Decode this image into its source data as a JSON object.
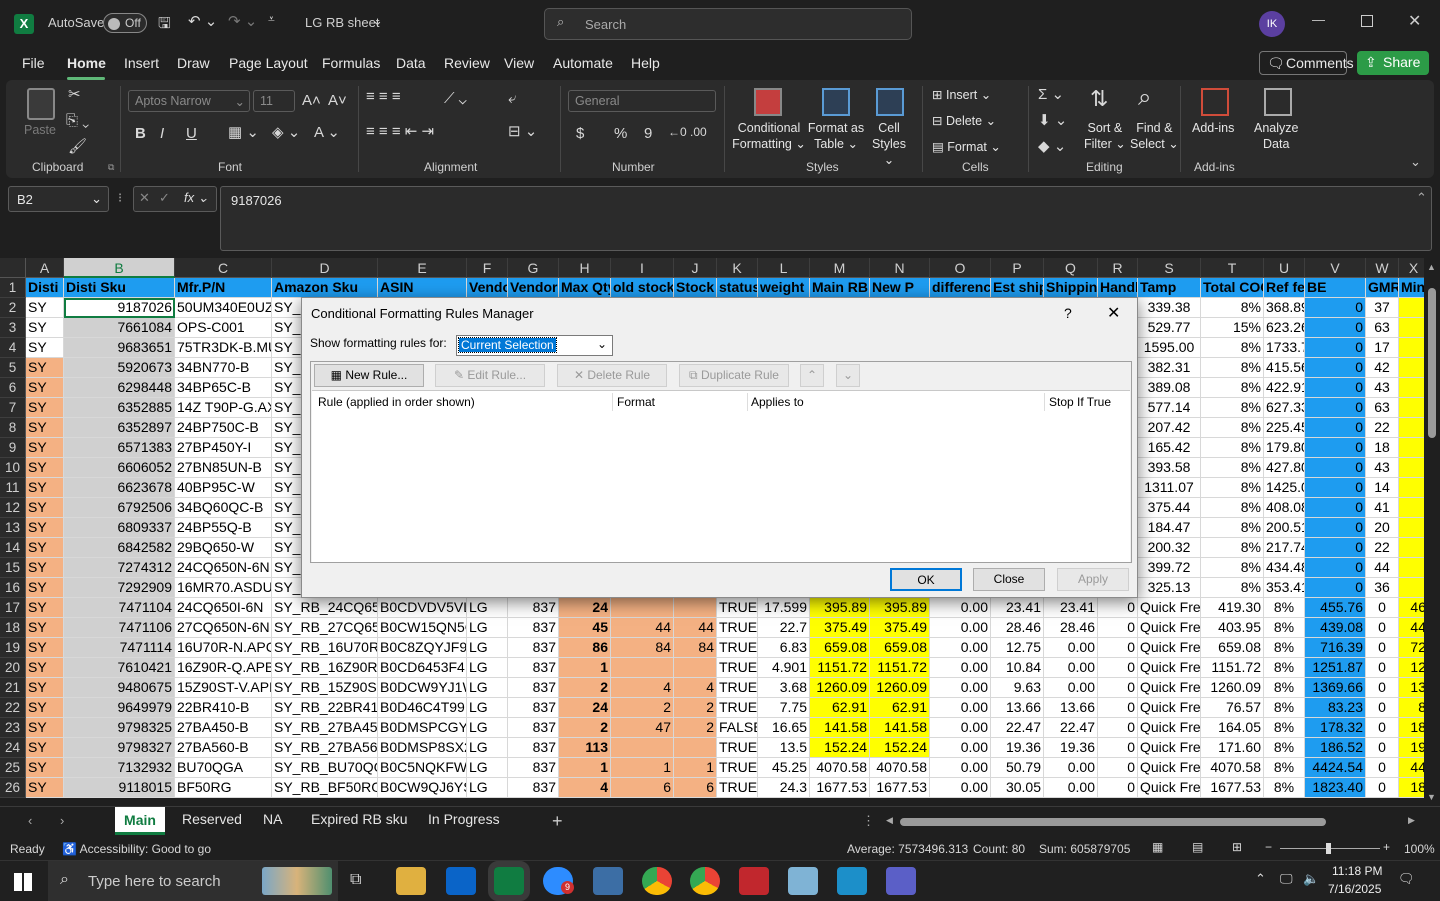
{
  "titlebar": {
    "autosave": "AutoSave",
    "toggle": "Off",
    "doc_title": "LG RB sheet",
    "search_placeholder": "Search",
    "avatar": "IK"
  },
  "menu": {
    "items": [
      "File",
      "Home",
      "Insert",
      "Draw",
      "Page Layout",
      "Formulas",
      "Data",
      "Review",
      "View",
      "Automate",
      "Help"
    ],
    "comments": "Comments",
    "share": "Share"
  },
  "ribbon": {
    "clipboard": {
      "paste": "Paste",
      "label": "Clipboard"
    },
    "font": {
      "name": "Aptos Narrow",
      "size": "11",
      "label": "Font",
      "bold": "B",
      "italic": "I",
      "underline": "U"
    },
    "alignment": {
      "label": "Alignment"
    },
    "number": {
      "format": "General",
      "label": "Number",
      "currency": "$",
      "percent": "%",
      "comma": "9"
    },
    "styles": {
      "cond": "Conditional",
      "cond2": "Formatting",
      "fmt_table": "Format as",
      "fmt_table2": "Table",
      "cell_styles": "Cell",
      "cell_styles2": "Styles",
      "label": "Styles"
    },
    "cells": {
      "insert": "Insert",
      "delete": "Delete",
      "format": "Format",
      "label": "Cells"
    },
    "editing": {
      "sort": "Sort &",
      "sort2": "Filter",
      "find": "Find &",
      "find2": "Select",
      "label": "Editing"
    },
    "addins": {
      "addins": "Add-ins",
      "analyze": "Analyze",
      "analyze2": "Data",
      "label": "Add-ins"
    }
  },
  "formula_bar": {
    "name_box": "B2",
    "value": "9187026"
  },
  "sheet": {
    "columns": [
      "A",
      "B",
      "C",
      "D",
      "E",
      "F",
      "G",
      "H",
      "I",
      "J",
      "K",
      "L",
      "M",
      "N",
      "O",
      "P",
      "Q",
      "R",
      "S",
      "T",
      "U",
      "V",
      "W",
      "X"
    ],
    "headers": [
      "Disti",
      "Disti Sku",
      "Mfr.P/N",
      "Amazon Sku",
      "ASIN",
      "Vendo",
      "Vendor",
      "Max Qty",
      "old stock",
      "Stock",
      "status",
      "weight",
      "Main RB P",
      "New P",
      "differenc",
      "Est ship",
      "Shipping",
      "Handl",
      "Tamp",
      "Total COG",
      "Ref fe",
      "BE",
      "GMR",
      "Min"
    ],
    "rows": [
      [
        "2",
        "SY",
        "9187026",
        "50UM340E0UZ",
        "SY_R",
        "",
        "",
        "",
        "",
        "",
        "",
        "",
        "",
        "",
        "",
        "",
        "",
        "",
        "LTL Shippi",
        "339.38",
        "8%",
        "368.89",
        "0",
        "37"
      ],
      [
        "3",
        "SY",
        "7661084",
        "OPS-C001",
        "SY_R",
        "",
        "",
        "",
        "",
        "",
        "",
        "",
        "",
        "",
        "",
        "",
        "",
        "",
        "Quick Frei",
        "529.77",
        "15%",
        "623.26",
        "0",
        "63"
      ],
      [
        "4",
        "SY",
        "9683651",
        "75TR3DK-B.MUS",
        "SY_R",
        "",
        "",
        "",
        "",
        "",
        "",
        "",
        "",
        "",
        "",
        "",
        "",
        "",
        "LTL Shippi",
        "1595.00",
        "8%",
        "1733.70",
        "0",
        "17"
      ],
      [
        "5",
        "SY",
        "5920673",
        "34BN770-B",
        "SY_R",
        "",
        "",
        "",
        "",
        "",
        "",
        "",
        "",
        "",
        "",
        "",
        "",
        "",
        "Quick Frei",
        "382.31",
        "8%",
        "415.56",
        "0",
        "42"
      ],
      [
        "6",
        "SY",
        "6298448",
        "34BP65C-B",
        "SY_R",
        "",
        "",
        "",
        "",
        "",
        "",
        "",
        "",
        "",
        "",
        "",
        "",
        "",
        "Quick Frei",
        "389.08",
        "8%",
        "422.91",
        "0",
        "43"
      ],
      [
        "7",
        "SY",
        "6352885",
        "14Z T90P-G.AX3",
        "SY_R",
        "",
        "",
        "",
        "",
        "",
        "",
        "",
        "",
        "",
        "",
        "",
        "",
        "",
        "Quick Frei",
        "577.14",
        "8%",
        "627.33",
        "0",
        "63"
      ],
      [
        "8",
        "SY",
        "6352897",
        "24BP750C-B",
        "SY_R",
        "",
        "",
        "",
        "",
        "",
        "",
        "",
        "",
        "",
        "",
        "",
        "",
        "",
        "Quick Frei",
        "207.42",
        "8%",
        "225.45",
        "0",
        "22"
      ],
      [
        "9",
        "SY",
        "6571383",
        "27BP450Y-I",
        "SY_R",
        "",
        "",
        "",
        "",
        "",
        "",
        "",
        "",
        "",
        "",
        "",
        "",
        "",
        "Quick Frei",
        "165.42",
        "8%",
        "179.80",
        "0",
        "18"
      ],
      [
        "10",
        "SY",
        "6606052",
        "27BN85UN-B",
        "SY_R",
        "",
        "",
        "",
        "",
        "",
        "",
        "",
        "",
        "",
        "",
        "",
        "",
        "",
        "Quick Frei",
        "393.58",
        "8%",
        "427.80",
        "0",
        "43"
      ],
      [
        "11",
        "SY",
        "6623678",
        "40BP95C-W",
        "SY_R",
        "",
        "",
        "",
        "",
        "",
        "",
        "",
        "",
        "",
        "",
        "",
        "",
        "",
        "LTL Shippi",
        "1311.07",
        "8%",
        "1425.08",
        "0",
        "14"
      ],
      [
        "12",
        "SY",
        "6792506",
        "34BQ60QC-B",
        "SY_R",
        "",
        "",
        "",
        "",
        "",
        "",
        "",
        "",
        "",
        "",
        "",
        "",
        "",
        "Quick Frei",
        "375.44",
        "8%",
        "408.08",
        "0",
        "41"
      ],
      [
        "13",
        "SY",
        "6809337",
        "24BP55Q-B",
        "SY_R",
        "",
        "",
        "",
        "",
        "",
        "",
        "",
        "",
        "",
        "",
        "",
        "",
        "",
        "Quick Frei",
        "184.47",
        "8%",
        "200.51",
        "0",
        "20"
      ],
      [
        "14",
        "SY",
        "6842582",
        "29BQ650-W",
        "SY_R",
        "",
        "",
        "",
        "",
        "",
        "",
        "",
        "",
        "",
        "",
        "",
        "",
        "",
        "Quick Frei",
        "200.32",
        "8%",
        "217.74",
        "0",
        "22"
      ],
      [
        "15",
        "SY",
        "7274312",
        "24CQ650N-6N",
        "SY_R",
        "",
        "",
        "",
        "",
        "",
        "",
        "",
        "",
        "",
        "",
        "",
        "",
        "",
        "Quick Frei",
        "399.72",
        "8%",
        "434.48",
        "0",
        "44"
      ],
      [
        "16",
        "SY",
        "7292909",
        "16MR70.ASDU",
        "SY_R",
        "",
        "",
        "",
        "",
        "",
        "",
        "",
        "",
        "",
        "",
        "",
        "",
        "",
        "Quick Frei",
        "325.13",
        "8%",
        "353.41",
        "0",
        "36"
      ],
      [
        "17",
        "SY",
        "7471104",
        "24CQ650I-6N",
        "SY_RB_24CQ650I-",
        "B0CDVDV5VL",
        "LG",
        "837",
        "24",
        "",
        "",
        "TRUE",
        "17.599",
        "395.89",
        "395.89",
        "0.00",
        "23.41",
        "23.41",
        "0",
        "Quick Frei",
        "419.30",
        "8%",
        "455.76",
        "0",
        "46"
      ],
      [
        "18",
        "SY",
        "7471106",
        "27CQ650N-6N",
        "SY_RB_27CQ650N",
        "B0CW15QN5G",
        "LG",
        "837",
        "45",
        "44",
        "44",
        "TRUE",
        "22.7",
        "375.49",
        "375.49",
        "0.00",
        "28.46",
        "28.46",
        "0",
        "Quick Frei",
        "403.95",
        "8%",
        "439.08",
        "0",
        "44"
      ],
      [
        "19",
        "SY",
        "7471114",
        "16U70R-N.APC5",
        "SY_RB_16U70R-N",
        "B0C8ZQYJF9",
        "LG",
        "837",
        "86",
        "84",
        "84",
        "TRUE",
        "6.83",
        "659.08",
        "659.08",
        "0.00",
        "12.75",
        "0.00",
        "0",
        "Quick Frei",
        "659.08",
        "8%",
        "716.39",
        "0",
        "72"
      ],
      [
        "20",
        "SY",
        "7610421",
        "16Z90R-Q.APB6",
        "SY_RB_16Z90R-Q.",
        "B0CD6453F4",
        "LG",
        "837",
        "1",
        "",
        "",
        "TRUE",
        "4.901",
        "1151.72",
        "1151.72",
        "0.00",
        "10.84",
        "0.00",
        "0",
        "Quick Frei",
        "1151.72",
        "8%",
        "1251.87",
        "0",
        "12"
      ],
      [
        "21",
        "SY",
        "9480675",
        "15Z90ST-V.APB6",
        "SY_RB_15Z90ST-V",
        "B0DCW9YJ1W",
        "LG",
        "837",
        "2",
        "4",
        "4",
        "TRUE",
        "3.68",
        "1260.09",
        "1260.09",
        "0.00",
        "9.63",
        "0.00",
        "0",
        "Quick Frei",
        "1260.09",
        "8%",
        "1369.66",
        "0",
        "13"
      ],
      [
        "22",
        "SY",
        "9649979",
        "22BR410-B",
        "SY_RB_22BR410-E",
        "B0D46C4T99",
        "LG",
        "837",
        "24",
        "2",
        "2",
        "TRUE",
        "7.75",
        "62.91",
        "62.91",
        "0.00",
        "13.66",
        "13.66",
        "0",
        "Quick Frei",
        "76.57",
        "8%",
        "83.23",
        "0",
        "8"
      ],
      [
        "23",
        "SY",
        "9798325",
        "27BA450-B",
        "SY_RB_27BA450-E",
        "B0DMSPCGYQ",
        "LG",
        "837",
        "2",
        "47",
        "2",
        "FALSE",
        "16.65",
        "141.58",
        "141.58",
        "0.00",
        "22.47",
        "22.47",
        "0",
        "Quick Frei",
        "164.05",
        "8%",
        "178.32",
        "0",
        "18"
      ],
      [
        "24",
        "SY",
        "9798327",
        "27BA560-B",
        "SY_RB_27BA560-E",
        "B0DMSP8SX2",
        "LG",
        "837",
        "113",
        "",
        "",
        "TRUE",
        "13.5",
        "152.24",
        "152.24",
        "0.00",
        "19.36",
        "19.36",
        "0",
        "Quick Frei",
        "171.60",
        "8%",
        "186.52",
        "0",
        "19"
      ],
      [
        "25",
        "SY",
        "7132932",
        "BU70QGA",
        "SY_RB_BU70QGA",
        "B0C5NQKFWP",
        "LG",
        "837",
        "1",
        "1",
        "1",
        "TRUE",
        "45.25",
        "4070.58",
        "4070.58",
        "0.00",
        "50.79",
        "0.00",
        "0",
        "Quick Frei",
        "4070.58",
        "8%",
        "4424.54",
        "0",
        "44"
      ],
      [
        "26",
        "SY",
        "9118015",
        "BF50RG",
        "SY_RB_BF50RG",
        "B0CW9QJ6YS",
        "LG",
        "837",
        "4",
        "6",
        "6",
        "TRUE",
        "24.3",
        "1677.53",
        "1677.53",
        "0.00",
        "30.05",
        "0.00",
        "0",
        "Quick Frei",
        "1677.53",
        "8%",
        "1823.40",
        "0",
        "18"
      ]
    ]
  },
  "dialog": {
    "title": "Conditional Formatting Rules Manager",
    "help": "?",
    "show_label": "Show formatting rules for:",
    "show_value": "Current Selection",
    "new_rule": "New Rule...",
    "edit_rule": "Edit Rule...",
    "delete_rule": "Delete Rule",
    "duplicate_rule": "Duplicate Rule",
    "col_rule": "Rule (applied in order shown)",
    "col_format": "Format",
    "col_applies": "Applies to",
    "col_stop": "Stop If True",
    "ok": "OK",
    "close": "Close",
    "apply": "Apply"
  },
  "tabs": {
    "items": [
      "Main",
      "Reserved",
      "NA",
      "Expired RB sku",
      "In Progress"
    ]
  },
  "status": {
    "ready": "Ready",
    "accessibility": "Accessibility: Good to go",
    "average": "Average: 7573496.313",
    "count": "Count: 80",
    "sum": "Sum: 605879705",
    "zoom": "100%"
  },
  "taskbar": {
    "search_placeholder": "Type here to search",
    "time": "11:18 PM",
    "date": "7/16/2025",
    "badge": "9"
  }
}
